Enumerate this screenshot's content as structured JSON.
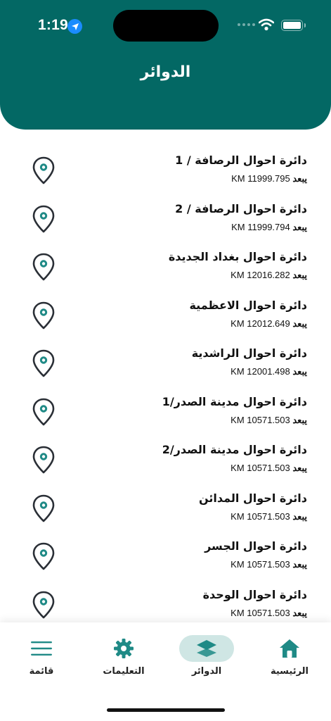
{
  "status": {
    "time": "1:19"
  },
  "header": {
    "title": "الدوائر"
  },
  "offices": [
    {
      "name": "دائرة احوال الرصافة / 1",
      "prefix": "يبعد",
      "distance": "KM 11999.795"
    },
    {
      "name": "دائرة احوال الرصافة / 2",
      "prefix": "يبعد",
      "distance": "KM 11999.794"
    },
    {
      "name": "دائرة احوال بغداد الجديدة",
      "prefix": "يبعد",
      "distance": "KM 12016.282"
    },
    {
      "name": "دائرة احوال الاعظمية",
      "prefix": "يبعد",
      "distance": "KM 12012.649"
    },
    {
      "name": "دائرة احوال الراشدية",
      "prefix": "يبعد",
      "distance": "KM 12001.498"
    },
    {
      "name": "دائرة احوال مدينة الصدر/1",
      "prefix": "يبعد",
      "distance": "KM 10571.503"
    },
    {
      "name": "دائرة احوال مدينة الصدر/2",
      "prefix": "يبعد",
      "distance": "KM 10571.503"
    },
    {
      "name": "دائرة احوال المدائن",
      "prefix": "يبعد",
      "distance": "KM 10571.503"
    },
    {
      "name": "دائرة احوال الجسر",
      "prefix": "يبعد",
      "distance": "KM 10571.503"
    },
    {
      "name": "دائرة احوال الوحدة",
      "prefix": "يبعد",
      "distance": "KM 10571.503"
    }
  ],
  "tabbar": {
    "menu": {
      "label": "قائمة",
      "icon": "menu-icon"
    },
    "instructions": {
      "label": "التعليمات",
      "icon": "gear-icon"
    },
    "offices": {
      "label": "الدوائر",
      "icon": "layers-icon",
      "active": true
    },
    "home": {
      "label": "الرئيسية",
      "icon": "home-icon"
    }
  },
  "colors": {
    "primary": "#036864",
    "accent": "#1f8a86",
    "active_pill": "#cfe6e4"
  }
}
